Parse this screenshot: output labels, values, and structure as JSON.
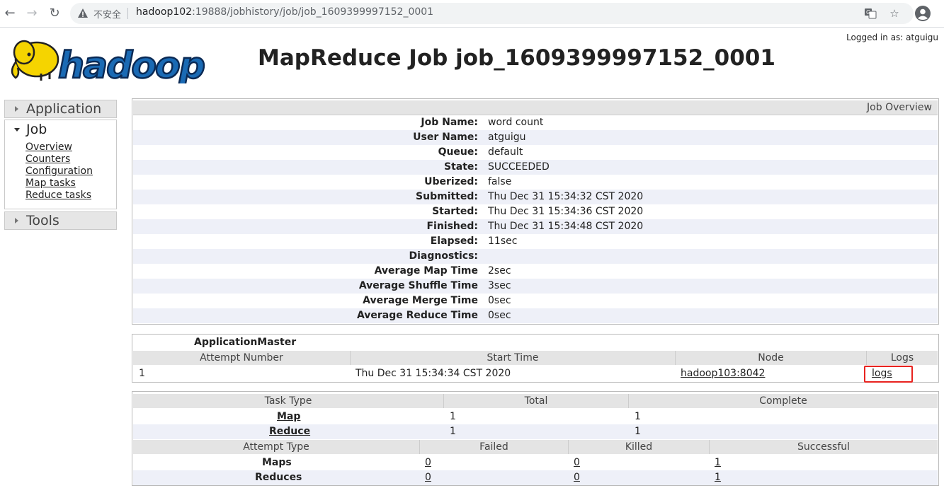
{
  "browser": {
    "security_label": "不安全",
    "url_host": "hadoop102",
    "url_rest": ":19888/jobhistory/job/job_1609399997152_0001"
  },
  "header": {
    "logo_text": "hadoop",
    "title": "MapReduce Job job_1609399997152_0001",
    "logged_in": "Logged in as: atguigu"
  },
  "sidebar": {
    "application_label": "Application",
    "job_label": "Job",
    "job_links": [
      "Overview",
      "Counters",
      "Configuration",
      "Map tasks",
      "Reduce tasks"
    ],
    "tools_label": "Tools"
  },
  "overview": {
    "header": "Job Overview",
    "rows": [
      {
        "key": "Job Name:",
        "value": "word count"
      },
      {
        "key": "User Name:",
        "value": "atguigu"
      },
      {
        "key": "Queue:",
        "value": "default"
      },
      {
        "key": "State:",
        "value": "SUCCEEDED"
      },
      {
        "key": "Uberized:",
        "value": "false"
      },
      {
        "key": "Submitted:",
        "value": "Thu Dec 31 15:34:32 CST 2020"
      },
      {
        "key": "Started:",
        "value": "Thu Dec 31 15:34:36 CST 2020"
      },
      {
        "key": "Finished:",
        "value": "Thu Dec 31 15:34:48 CST 2020"
      },
      {
        "key": "Elapsed:",
        "value": "11sec"
      },
      {
        "key": "Diagnostics:",
        "value": ""
      },
      {
        "key": "Average Map Time",
        "value": "2sec"
      },
      {
        "key": "Average Shuffle Time",
        "value": "3sec"
      },
      {
        "key": "Average Merge Time",
        "value": "0sec"
      },
      {
        "key": "Average Reduce Time",
        "value": "0sec"
      }
    ]
  },
  "app_master": {
    "title": "ApplicationMaster",
    "columns": [
      "Attempt Number",
      "Start Time",
      "Node",
      "Logs"
    ],
    "row": {
      "attempt": "1",
      "start_time": "Thu Dec 31 15:34:34 CST 2020",
      "node": "hadoop103:8042",
      "logs": "logs"
    }
  },
  "tasks": {
    "columns": [
      "Task Type",
      "Total",
      "Complete"
    ],
    "rows": [
      {
        "type": "Map",
        "total": "1",
        "complete": "1"
      },
      {
        "type": "Reduce",
        "total": "1",
        "complete": "1"
      }
    ],
    "attempt_columns": [
      "Attempt Type",
      "Failed",
      "Killed",
      "Successful"
    ],
    "attempt_rows": [
      {
        "type": "Maps",
        "failed": "0",
        "killed": "0",
        "successful": "1"
      },
      {
        "type": "Reduces",
        "failed": "0",
        "killed": "0",
        "successful": "1"
      }
    ]
  },
  "colors": {
    "highlight_box": "#e8231f",
    "logo_yellow": "#f5d400",
    "logo_blue": "#1a6ab4"
  }
}
